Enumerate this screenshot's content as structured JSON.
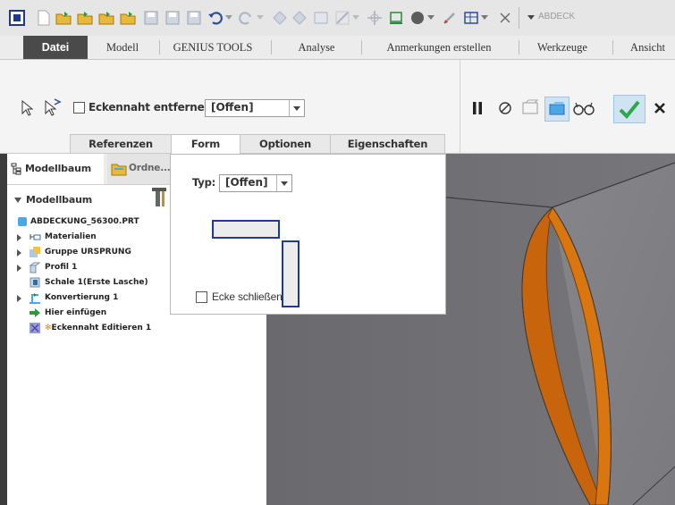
{
  "window": {
    "title": "ABDECK"
  },
  "ribbon": {
    "tabs": [
      "Datei",
      "Modell",
      "GENIUS TOOLS",
      "Analyse",
      "Anmerkungen erstellen",
      "Werkzeuge",
      "Ansicht"
    ],
    "active_tab": "Datei"
  },
  "dashboard": {
    "remove_corner_seam_label": "Eckennaht entfernen",
    "open_combo_value": "[Offen]",
    "panel_tabs": [
      "Referenzen",
      "Form",
      "Optionen",
      "Eigenschaften"
    ],
    "active_panel_tab": "Form"
  },
  "form_panel": {
    "type_label": "Typ:",
    "type_value": "[Offen]",
    "close_corner_label": "Ecke schließen"
  },
  "model_tree": {
    "tab_modellbaum": "Modellbaum",
    "tab_ordner": "Ordne...",
    "header": "Modellbaum",
    "items": [
      "ABDECKUNG_56300.PRT",
      "Materialien",
      "Gruppe URSPRUNG",
      "Profil 1",
      "Schale 1(Erste Lasche)",
      "Konvertierung 1",
      "Hier einfügen",
      "Eckennaht Editieren 1"
    ]
  },
  "colors": {
    "accent_blue": "#1f3a93",
    "ok_green": "#2aa84a",
    "edge_orange": "#c8650c",
    "surface_gray": "#77777b"
  }
}
